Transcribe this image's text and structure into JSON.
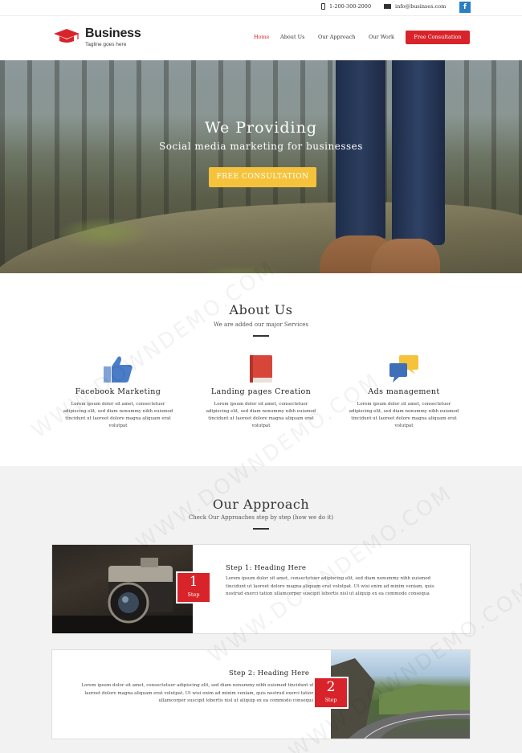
{
  "topbar": {
    "phone": "1-200-300-2000",
    "email": "info@businses.com",
    "social_icon": "f"
  },
  "header": {
    "logo_name": "Business",
    "logo_tagline": "Tagline goes here",
    "nav": [
      "Home",
      "About Us",
      "Our Approach",
      "Our Work"
    ],
    "cta": "Free Consultation"
  },
  "hero": {
    "title": "We Providing",
    "subtitle": "Social media marketing for businesses",
    "button": "FREE CONSULTATION"
  },
  "about": {
    "title": "About Us",
    "subtitle": "We are added our major Services",
    "features": [
      {
        "title": "Facebook Marketing",
        "icon": "thumbs-up-icon",
        "text": "Lorem ipsum dolor sit amet, consectetuer adipiscing elit, sed diam nonummy nibh euismod tincidunt ut laoreet dolore magna aliquam erat volutpat"
      },
      {
        "title": "Landing pages Creation",
        "icon": "book-icon",
        "text": "Lorem ipsum dolor sit amet, consectetuer adipiscing elit, sed diam nonummy nibh euismod tincidunt ut laoreet dolore magna aliquam erat volutpat"
      },
      {
        "title": "Ads management",
        "icon": "chat-bubbles-icon",
        "text": "Lorem ipsum dolor sit amet, consectetuer adipiscing elit, sed diam nonummy nibh euismod tincidunt ut laoreet dolore magna aliquam erat volutpat"
      }
    ]
  },
  "approach": {
    "title": "Our Approach",
    "subtitle": "Check Our Approaches step by step (how we do it)",
    "steps": [
      {
        "number": "1",
        "label": "Step",
        "title": "Step 1: Heading Here",
        "text": "Lorem ipsum dolor sit amet, consectetuer adipiscing elit, sed diam nonummy nibh euismod tincidunt ut laoreet dolore magna aliquam erat volutpat. Ut wisi enim ad minim veniam, quis nostrud exerci tation ullamcorper suscipit lobortis nisl ut aliquip ex ea commodo consequa"
      },
      {
        "number": "2",
        "label": "Step",
        "title": "Step 2: Heading Here",
        "text": "Lorem ipsum dolor sit amet, consectetuer adipiscing elit, sed diam nonummy nibh euismod tincidunt ut laoreet dolore magna aliquam erat volutpat. Ut wisi enim ad minim veniam, quis nostrud exerci tation ullamcorper suscipit lobortis nisl ut aliquip ex ea commodo consequa"
      }
    ]
  },
  "watermark": "WWW.DOWNDEMO.COM",
  "colors": {
    "accent": "#d8232a",
    "hero_button": "#f5c23b",
    "facebook": "#2b7ec2"
  }
}
